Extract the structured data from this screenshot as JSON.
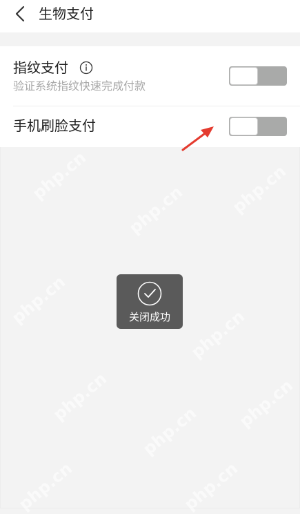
{
  "header": {
    "title": "生物支付",
    "back_icon": "chevron-left-icon"
  },
  "settings": {
    "fingerprint": {
      "title": "指纹支付",
      "subtitle": "验证系统指纹快速完成付款",
      "info_icon": "info-icon",
      "enabled": false
    },
    "face": {
      "title": "手机刷脸支付",
      "enabled": false
    }
  },
  "annotation": {
    "arrow_color": "#e43b2f"
  },
  "toast": {
    "text": "关闭成功",
    "icon": "checkmark-circle-icon"
  },
  "watermark": "php.cn",
  "colors": {
    "background": "#f3f3f3",
    "toggle_off": "#a9aaa9",
    "toast_bg": "#5a5a5a",
    "subtitle": "#a7a7a7"
  }
}
